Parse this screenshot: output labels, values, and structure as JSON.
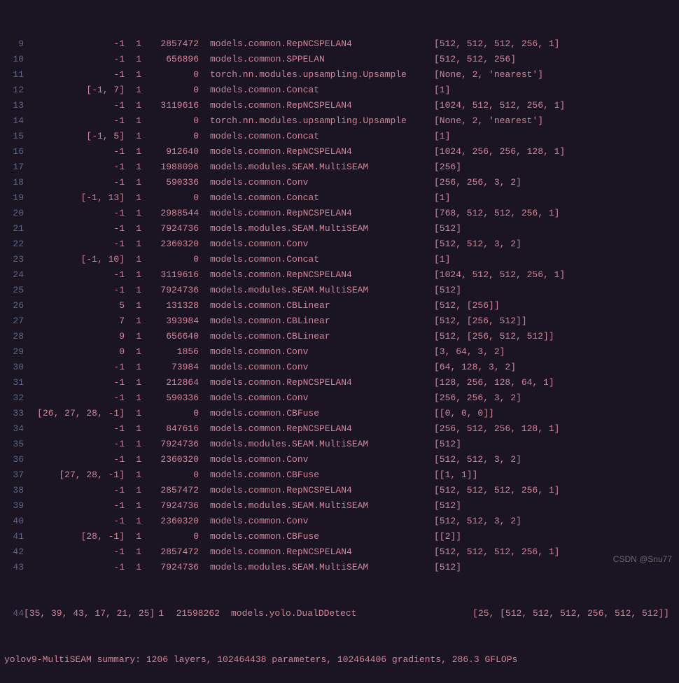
{
  "rows": [
    {
      "num": "9",
      "from": "-1",
      "n": "1",
      "params": "2857472",
      "module": "models.common.RepNCSPELAN4",
      "args": "[512, 512, 512, 256, 1]"
    },
    {
      "num": "10",
      "from": "-1",
      "n": "1",
      "params": "656896",
      "module": "models.common.SPPELAN",
      "args": "[512, 512, 256]"
    },
    {
      "num": "11",
      "from": "-1",
      "n": "1",
      "params": "0",
      "module": "torch.nn.modules.upsampling.Upsample",
      "args": "[None, 2, 'nearest']"
    },
    {
      "num": "12",
      "from": "[-1, 7]",
      "n": "1",
      "params": "0",
      "module": "models.common.Concat",
      "args": "[1]"
    },
    {
      "num": "13",
      "from": "-1",
      "n": "1",
      "params": "3119616",
      "module": "models.common.RepNCSPELAN4",
      "args": "[1024, 512, 512, 256, 1]"
    },
    {
      "num": "14",
      "from": "-1",
      "n": "1",
      "params": "0",
      "module": "torch.nn.modules.upsampling.Upsample",
      "args": "[None, 2, 'nearest']"
    },
    {
      "num": "15",
      "from": "[-1, 5]",
      "n": "1",
      "params": "0",
      "module": "models.common.Concat",
      "args": "[1]"
    },
    {
      "num": "16",
      "from": "-1",
      "n": "1",
      "params": "912640",
      "module": "models.common.RepNCSPELAN4",
      "args": "[1024, 256, 256, 128, 1]"
    },
    {
      "num": "17",
      "from": "-1",
      "n": "1",
      "params": "1988096",
      "module": "models.modules.SEAM.MultiSEAM",
      "args": "[256]"
    },
    {
      "num": "18",
      "from": "-1",
      "n": "1",
      "params": "590336",
      "module": "models.common.Conv",
      "args": "[256, 256, 3, 2]"
    },
    {
      "num": "19",
      "from": "[-1, 13]",
      "n": "1",
      "params": "0",
      "module": "models.common.Concat",
      "args": "[1]"
    },
    {
      "num": "20",
      "from": "-1",
      "n": "1",
      "params": "2988544",
      "module": "models.common.RepNCSPELAN4",
      "args": "[768, 512, 512, 256, 1]"
    },
    {
      "num": "21",
      "from": "-1",
      "n": "1",
      "params": "7924736",
      "module": "models.modules.SEAM.MultiSEAM",
      "args": "[512]"
    },
    {
      "num": "22",
      "from": "-1",
      "n": "1",
      "params": "2360320",
      "module": "models.common.Conv",
      "args": "[512, 512, 3, 2]"
    },
    {
      "num": "23",
      "from": "[-1, 10]",
      "n": "1",
      "params": "0",
      "module": "models.common.Concat",
      "args": "[1]"
    },
    {
      "num": "24",
      "from": "-1",
      "n": "1",
      "params": "3119616",
      "module": "models.common.RepNCSPELAN4",
      "args": "[1024, 512, 512, 256, 1]"
    },
    {
      "num": "25",
      "from": "-1",
      "n": "1",
      "params": "7924736",
      "module": "models.modules.SEAM.MultiSEAM",
      "args": "[512]"
    },
    {
      "num": "26",
      "from": "5",
      "n": "1",
      "params": "131328",
      "module": "models.common.CBLinear",
      "args": "[512, [256]]"
    },
    {
      "num": "27",
      "from": "7",
      "n": "1",
      "params": "393984",
      "module": "models.common.CBLinear",
      "args": "[512, [256, 512]]"
    },
    {
      "num": "28",
      "from": "9",
      "n": "1",
      "params": "656640",
      "module": "models.common.CBLinear",
      "args": "[512, [256, 512, 512]]"
    },
    {
      "num": "29",
      "from": "0",
      "n": "1",
      "params": "1856",
      "module": "models.common.Conv",
      "args": "[3, 64, 3, 2]"
    },
    {
      "num": "30",
      "from": "-1",
      "n": "1",
      "params": "73984",
      "module": "models.common.Conv",
      "args": "[64, 128, 3, 2]"
    },
    {
      "num": "31",
      "from": "-1",
      "n": "1",
      "params": "212864",
      "module": "models.common.RepNCSPELAN4",
      "args": "[128, 256, 128, 64, 1]"
    },
    {
      "num": "32",
      "from": "-1",
      "n": "1",
      "params": "590336",
      "module": "models.common.Conv",
      "args": "[256, 256, 3, 2]"
    },
    {
      "num": "33",
      "from": "[26, 27, 28, -1]",
      "n": "1",
      "params": "0",
      "module": "models.common.CBFuse",
      "args": "[[0, 0, 0]]"
    },
    {
      "num": "34",
      "from": "-1",
      "n": "1",
      "params": "847616",
      "module": "models.common.RepNCSPELAN4",
      "args": "[256, 512, 256, 128, 1]"
    },
    {
      "num": "35",
      "from": "-1",
      "n": "1",
      "params": "7924736",
      "module": "models.modules.SEAM.MultiSEAM",
      "args": "[512]"
    },
    {
      "num": "36",
      "from": "-1",
      "n": "1",
      "params": "2360320",
      "module": "models.common.Conv",
      "args": "[512, 512, 3, 2]"
    },
    {
      "num": "37",
      "from": "[27, 28, -1]",
      "n": "1",
      "params": "0",
      "module": "models.common.CBFuse",
      "args": "[[1, 1]]"
    },
    {
      "num": "38",
      "from": "-1",
      "n": "1",
      "params": "2857472",
      "module": "models.common.RepNCSPELAN4",
      "args": "[512, 512, 512, 256, 1]"
    },
    {
      "num": "39",
      "from": "-1",
      "n": "1",
      "params": "7924736",
      "module": "models.modules.SEAM.MultiSEAM",
      "args": "[512]"
    },
    {
      "num": "40",
      "from": "-1",
      "n": "1",
      "params": "2360320",
      "module": "models.common.Conv",
      "args": "[512, 512, 3, 2]"
    },
    {
      "num": "41",
      "from": "[28, -1]",
      "n": "1",
      "params": "0",
      "module": "models.common.CBFuse",
      "args": "[[2]]"
    },
    {
      "num": "42",
      "from": "-1",
      "n": "1",
      "params": "2857472",
      "module": "models.common.RepNCSPELAN4",
      "args": "[512, 512, 512, 256, 1]"
    },
    {
      "num": "43",
      "from": "-1",
      "n": "1",
      "params": "7924736",
      "module": "models.modules.SEAM.MultiSEAM",
      "args": "[512]"
    }
  ],
  "special_row": {
    "num": "44",
    "from": "[35, 39, 43, 17, 21, 25]",
    "n": "1",
    "params": "21598262",
    "module": "models.yolo.DualDDetect",
    "args": "[25, [512, 512, 512, 256, 512, 512]]"
  },
  "summary": "yolov9-MultiSEAM summary: 1206 layers, 102464438 parameters, 102464406 gradients, 286.3 GFLOPs",
  "watermark": "CSDN @Snu77"
}
